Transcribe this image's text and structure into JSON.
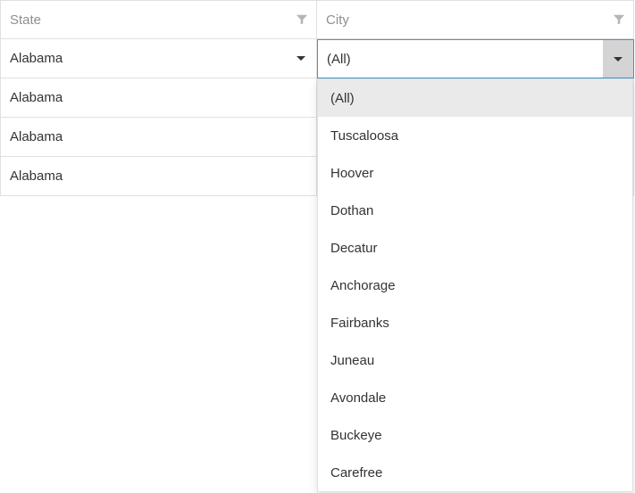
{
  "columns": {
    "state": {
      "header": "State",
      "filter_value": "Alabama"
    },
    "city": {
      "header": "City",
      "filter_value": "(All)"
    }
  },
  "rows": [
    {
      "state": "Alabama"
    },
    {
      "state": "Alabama"
    },
    {
      "state": "Alabama"
    }
  ],
  "city_dropdown": {
    "highlighted": "(All)",
    "items": [
      "(All)",
      "Tuscaloosa",
      "Hoover",
      "Dothan",
      "Decatur",
      "Anchorage",
      "Fairbanks",
      "Juneau",
      "Avondale",
      "Buckeye",
      "Carefree"
    ]
  }
}
